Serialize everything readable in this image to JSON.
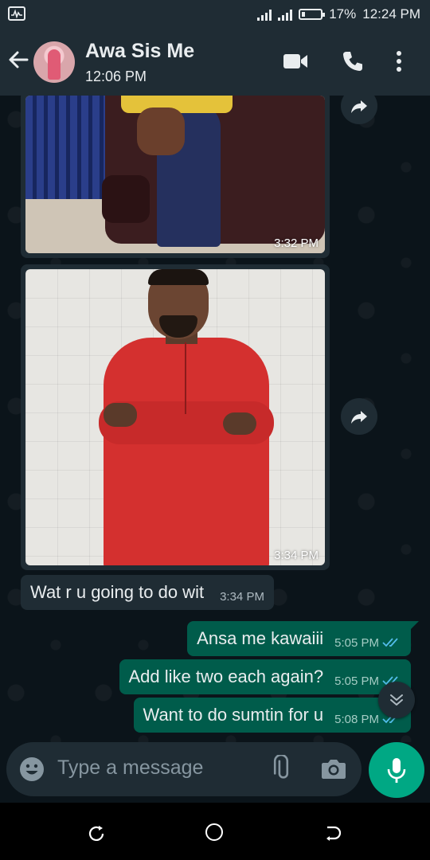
{
  "status_bar": {
    "battery": "17%",
    "time": "12:24 PM"
  },
  "header": {
    "contact_name": "Awa Sis Me",
    "last_seen": "12:06 PM"
  },
  "messages": {
    "image1": {
      "time": "3:32 PM"
    },
    "image2": {
      "time": "3:34 PM"
    },
    "incoming": {
      "text": "Wat r u going to do wit",
      "time": "3:34 PM"
    },
    "outgoing": [
      {
        "text": "Ansa me kawaiii",
        "time": "5:05 PM",
        "status": "read"
      },
      {
        "text": "Add like two each again?",
        "time": "5:05 PM",
        "status": "read"
      },
      {
        "text": "Want to do sumtin for u",
        "time": "5:08 PM",
        "status": "read"
      }
    ]
  },
  "composer": {
    "placeholder": "Type a message"
  },
  "colors": {
    "accent": "#00a884",
    "outgoing_bubble": "#005c4b",
    "incoming_bubble": "#1f2c34",
    "read_ticks": "#53bdeb"
  },
  "icons": [
    "activity-icon",
    "signal-icon",
    "battery-icon",
    "back-arrow-icon",
    "video-call-icon",
    "phone-icon",
    "more-vert-icon",
    "forward-icon",
    "double-check-icon",
    "scroll-down-icon",
    "emoji-icon",
    "attach-icon",
    "camera-icon",
    "mic-icon"
  ]
}
